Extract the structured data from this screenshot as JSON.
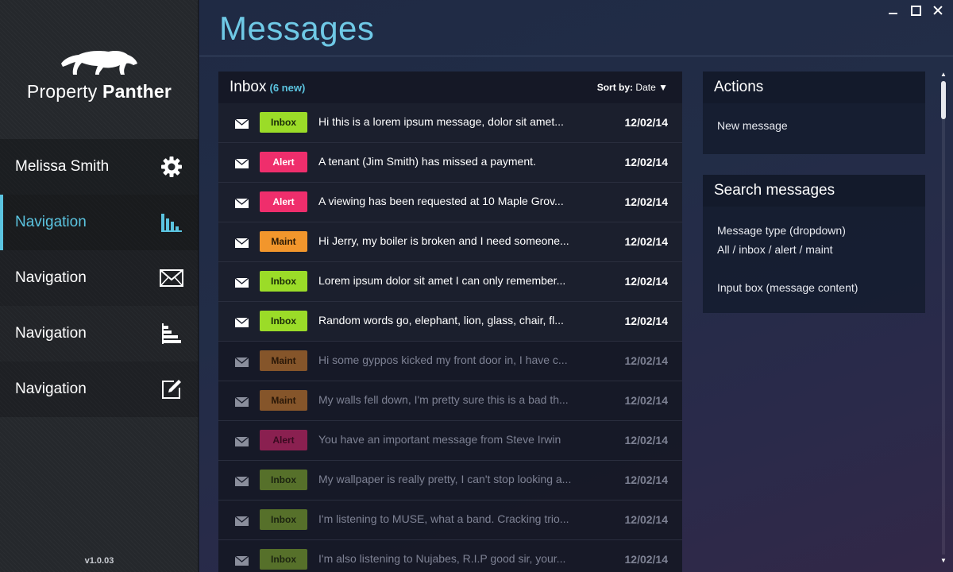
{
  "window": {
    "controls": [
      "minimize",
      "maximize",
      "close"
    ]
  },
  "brand": {
    "name_light": "Property",
    "name_bold": "Panther",
    "logo_icon": "panther-logo-icon"
  },
  "sidebar": {
    "items": [
      {
        "label": "Melissa Smith",
        "icon": "gear-icon",
        "active": false
      },
      {
        "label": "Navigation",
        "icon": "bar-chart-icon",
        "active": true
      },
      {
        "label": "Navigation",
        "icon": "envelope-icon",
        "active": false
      },
      {
        "label": "Navigation",
        "icon": "horizontal-bar-chart-icon",
        "active": false
      },
      {
        "label": "Navigation",
        "icon": "edit-icon",
        "active": false
      }
    ],
    "version": "v1.0.03"
  },
  "page": {
    "title": "Messages"
  },
  "inbox": {
    "title": "Inbox",
    "new_count": "(6 new)",
    "sort_label": "Sort by:",
    "sort_value": "Date",
    "sort_arrow": "▼",
    "messages": [
      {
        "type": "Inbox",
        "text": "Hi this is a lorem ipsum message, dolor sit amet...",
        "date": "12/02/14",
        "unread": true
      },
      {
        "type": "Alert",
        "text": "A tenant (Jim Smith) has missed a payment.",
        "date": "12/02/14",
        "unread": true
      },
      {
        "type": "Alert",
        "text": "A viewing has been requested at 10 Maple Grov...",
        "date": "12/02/14",
        "unread": true
      },
      {
        "type": "Maint",
        "text": "Hi Jerry, my boiler is broken and I need someone...",
        "date": "12/02/14",
        "unread": true
      },
      {
        "type": "Inbox",
        "text": "Lorem ipsum dolor sit amet I can only remember...",
        "date": "12/02/14",
        "unread": true
      },
      {
        "type": "Inbox",
        "text": "Random words go, elephant, lion, glass, chair, fl...",
        "date": "12/02/14",
        "unread": true
      },
      {
        "type": "Maint",
        "text": "Hi some gyppos kicked my front door in, I have c...",
        "date": "12/02/14",
        "unread": false
      },
      {
        "type": "Maint",
        "text": "My walls fell down, I'm pretty sure this is a bad th...",
        "date": "12/02/14",
        "unread": false
      },
      {
        "type": "Alert",
        "text": "You have an important message from Steve Irwin",
        "date": "12/02/14",
        "unread": false
      },
      {
        "type": "Inbox",
        "text": "My wallpaper is really pretty, I can't stop looking a...",
        "date": "12/02/14",
        "unread": false
      },
      {
        "type": "Inbox",
        "text": "I'm listening to MUSE, what a band. Cracking trio...",
        "date": "12/02/14",
        "unread": false
      },
      {
        "type": "Inbox",
        "text": "I'm also listening to Nujabes, R.I.P good sir, your...",
        "date": "12/02/14",
        "unread": false
      }
    ]
  },
  "actions": {
    "title": "Actions",
    "new_message": "New message"
  },
  "search": {
    "title": "Search messages",
    "type_label": "Message type (dropdown)",
    "type_options": "All / inbox / alert / maint",
    "content_label": "Input box (message content)"
  },
  "colors": {
    "accent": "#5bc4e0",
    "badge_inbox": "#9bdc28",
    "badge_alert": "#ef2e6c",
    "badge_maint": "#f2962c"
  },
  "scrollbar": {
    "up_arrow": "▲",
    "down_arrow": "▼"
  }
}
